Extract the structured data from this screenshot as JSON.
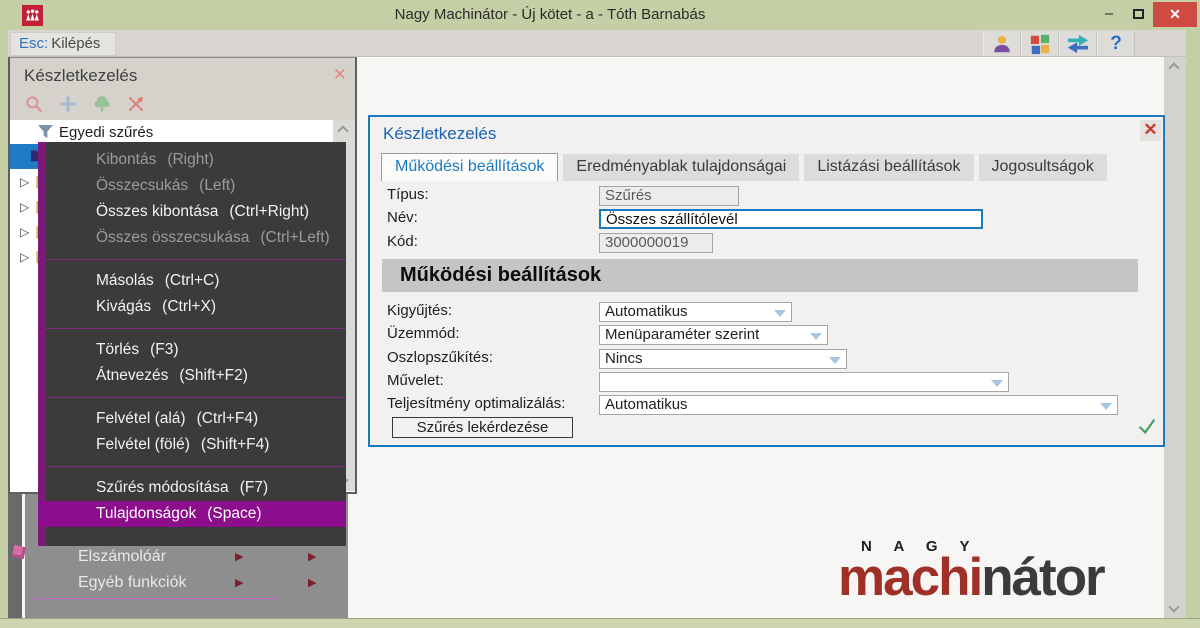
{
  "window": {
    "title": "Nagy Machinátor - Új kötet - a - Tóth Barnabás"
  },
  "window_controls": {
    "minimize": "–",
    "close": "✕"
  },
  "toolbar": {
    "exit_key": "Esc:",
    "exit_label": "Kilépés",
    "icons": [
      "user-icon",
      "apps-grid-icon",
      "transfer-arrows-icon",
      "help-icon"
    ],
    "help_glyph": "?"
  },
  "left_panel": {
    "title": "Készletkezelés",
    "close_glyph": "✕",
    "icons": [
      "search-icon",
      "add-icon",
      "tree-icon",
      "pin-icon"
    ],
    "filter_label": "Egyedi szűrés",
    "tree_expand_glyph": "▷"
  },
  "context_menu": {
    "items": [
      {
        "label": "Kibontás",
        "shortcut": "(Right)",
        "state": "disabled"
      },
      {
        "label": "Összecsukás",
        "shortcut": "(Left)",
        "state": "disabled"
      },
      {
        "label": "Összes kibontása",
        "shortcut": "(Ctrl+Right)",
        "state": "enabled"
      },
      {
        "label": "Összes összecsukása",
        "shortcut": "(Ctrl+Left)",
        "state": "disabled"
      },
      {
        "label": "Másolás",
        "shortcut": "(Ctrl+C)",
        "state": "enabled"
      },
      {
        "label": "Kivágás",
        "shortcut": "(Ctrl+X)",
        "state": "enabled"
      },
      {
        "label": "Törlés",
        "shortcut": "(F3)",
        "state": "enabled"
      },
      {
        "label": "Átnevezés",
        "shortcut": "(Shift+F2)",
        "state": "enabled"
      },
      {
        "label": "Felvétel (alá)",
        "shortcut": "(Ctrl+F4)",
        "state": "enabled"
      },
      {
        "label": "Felvétel (fölé)",
        "shortcut": "(Shift+F4)",
        "state": "enabled"
      },
      {
        "label": "Szűrés módosítása",
        "shortcut": "(F7)",
        "state": "enabled"
      },
      {
        "label": "Tulajdonságok",
        "shortcut": "(Space)",
        "state": "highlighted"
      }
    ]
  },
  "back_menu": {
    "items": [
      {
        "label": "Elszámolóár",
        "arrow": "▶"
      },
      {
        "label": "Egyéb funkciók",
        "arrow": "▶"
      }
    ]
  },
  "dialog": {
    "title": "Készletkezelés",
    "close_glyph": "✕",
    "tabs": [
      {
        "label": "Működési beállítások",
        "active": true
      },
      {
        "label": "Eredményablak tulajdonságai",
        "active": false
      },
      {
        "label": "Listázási beállítások",
        "active": false
      },
      {
        "label": "Jogosultságok",
        "active": false
      }
    ],
    "info_fields": [
      {
        "label": "Típus:",
        "value": "Szűrés",
        "state": "readonly"
      },
      {
        "label": "Név:",
        "value": "Összes szállítólevél",
        "state": "active"
      },
      {
        "label": "Kód:",
        "value": "3000000019",
        "state": "readonly"
      }
    ],
    "section_title": "Működési beállítások",
    "setting_fields": [
      {
        "label": "Kigyűjtés:",
        "value": "Automatikus"
      },
      {
        "label": "Üzemmód:",
        "value": "Menüparaméter szerint"
      },
      {
        "label": "Oszlopszűkítés:",
        "value": "Nincs"
      },
      {
        "label": "Művelet:",
        "value": ""
      },
      {
        "label": "Teljesítmény optimalizálás:",
        "value": "Automatikus"
      }
    ],
    "query_button": "Szűrés lekérdezése"
  },
  "logo": {
    "small": "N A G Y",
    "red": "machi",
    "dark": "nátor"
  },
  "colors": {
    "accent_blue": "#1a7ac0",
    "menu_purple": "#8c0e8c",
    "close_red": "#cf4a41",
    "check_green": "#45a06a",
    "logo_red": "#9e3028",
    "frame_olive": "#c5cfa5",
    "selection_blue": "#1e7bc4"
  }
}
